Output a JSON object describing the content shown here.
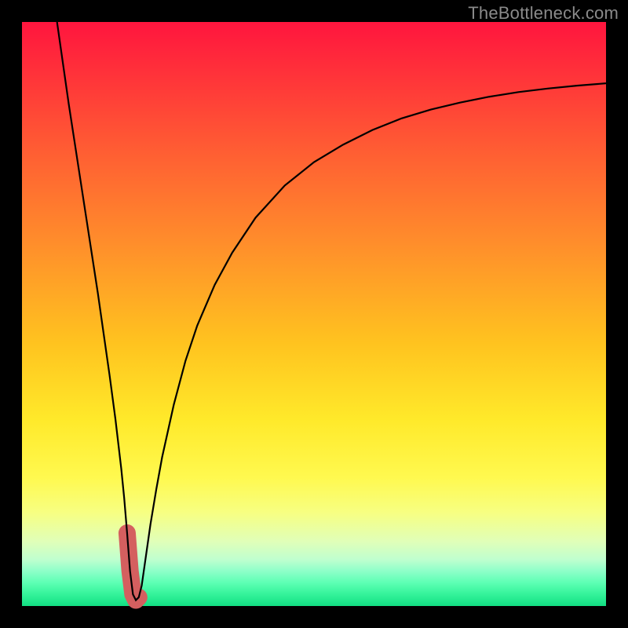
{
  "watermark": "TheBottleneck.com",
  "chart_data": {
    "type": "line",
    "title": "",
    "xlabel": "",
    "ylabel": "",
    "xlim": [
      0,
      100
    ],
    "ylim": [
      0,
      100
    ],
    "grid": false,
    "series": [
      {
        "name": "bottleneck-curve",
        "x": [
          6,
          7,
          8,
          9,
          10,
          11,
          12,
          13,
          14,
          15,
          16,
          17,
          17.5,
          18,
          18.5,
          19,
          19.5,
          20,
          20.5,
          21,
          22,
          23,
          24,
          26,
          28,
          30,
          33,
          36,
          40,
          45,
          50,
          55,
          60,
          65,
          70,
          75,
          80,
          85,
          90,
          95,
          100
        ],
        "values": [
          100,
          93,
          86,
          79.5,
          73,
          66.5,
          60,
          53.5,
          46.5,
          39.5,
          32,
          23.5,
          18.5,
          12.5,
          6,
          2,
          1,
          1.5,
          3.5,
          7,
          14,
          20,
          25.5,
          34.5,
          42,
          48,
          55,
          60.5,
          66.5,
          72,
          76,
          79,
          81.5,
          83.5,
          85,
          86.2,
          87.2,
          88,
          88.6,
          89.1,
          89.5
        ]
      }
    ],
    "annotations": [
      {
        "name": "trough-highlight",
        "x_range": [
          18,
          20.2
        ],
        "y_range": [
          0.5,
          5.5
        ]
      }
    ]
  },
  "colors": {
    "curve": "#000000",
    "trough_highlight": "#d45f5f",
    "gradient_top": "#ff153e",
    "gradient_bottom": "#12df83",
    "frame": "#000000"
  }
}
